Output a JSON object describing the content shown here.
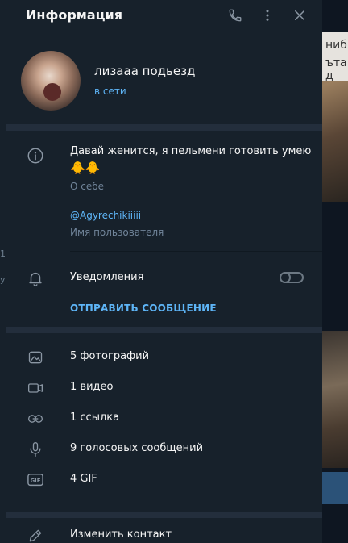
{
  "header": {
    "title": "Информация"
  },
  "profile": {
    "name": "лизааа подьезд",
    "status": "в сети"
  },
  "about": {
    "bio": "Давай женится, я пельмени готовить умею",
    "bio_emoji": "🐥🐥",
    "bio_caption": "О себе",
    "username": "@Agyrechikiiiii",
    "username_caption": "Имя пользователя"
  },
  "notifications": {
    "label": "Уведомления",
    "enabled": false
  },
  "send_message_label": "ОТПРАВИТЬ СООБЩЕНИЕ",
  "media": [
    {
      "icon": "photo-icon",
      "label": "5 фотографий"
    },
    {
      "icon": "video-icon",
      "label": "1 видео"
    },
    {
      "icon": "link-icon",
      "label": "1 ссылка"
    },
    {
      "icon": "microphone-icon",
      "label": "9 голосовых сообщений"
    },
    {
      "icon": "gif-icon",
      "label": "4 GIF"
    }
  ],
  "edit_contact_label": "Изменить контакт",
  "background": {
    "right_text_1": "ниб",
    "right_text_2": "ъта д",
    "left_text_1": "1",
    "left_text_2": "уд"
  },
  "colors": {
    "panel_bg": "#17212b",
    "separator": "#232e3c",
    "accent": "#5eb5f7",
    "muted": "#708499",
    "icon": "#8a96a3"
  }
}
